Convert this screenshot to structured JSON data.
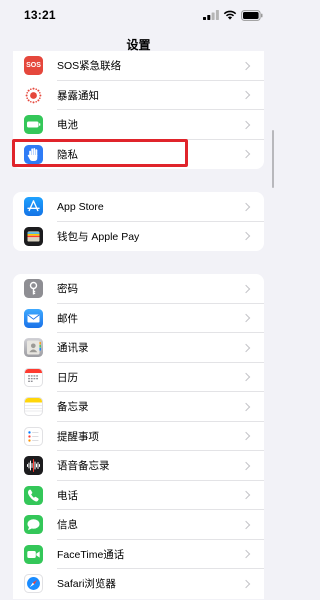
{
  "status_bar": {
    "time": "13:21"
  },
  "nav": {
    "title": "设置"
  },
  "group1": [
    {
      "label": "SOS紧急联络",
      "icon": "sos-icon",
      "color": "#e5473c",
      "icon_text": "SOS"
    },
    {
      "label": "暴露通知",
      "icon": "exposure-notification-icon",
      "color": "#ffffff"
    },
    {
      "label": "电池",
      "icon": "battery-icon",
      "color": "#34c759"
    },
    {
      "label": "隐私",
      "icon": "hand-icon",
      "color": "#2f7cf6"
    }
  ],
  "group2": [
    {
      "label": "App Store",
      "icon": "app-store-icon",
      "color": "#1a8cff"
    },
    {
      "label": "钱包与 Apple Pay",
      "icon": "wallet-icon",
      "color": "#1c1c1e"
    }
  ],
  "group3": [
    {
      "label": "密码",
      "icon": "key-icon",
      "color": "#8e8e93"
    },
    {
      "label": "邮件",
      "icon": "mail-icon",
      "color": "#2b8cf0"
    },
    {
      "label": "通讯录",
      "icon": "contacts-icon",
      "color": "#a6a6ab"
    },
    {
      "label": "日历",
      "icon": "calendar-icon",
      "color": "#ffffff"
    },
    {
      "label": "备忘录",
      "icon": "notes-icon",
      "color": "#ffd60a"
    },
    {
      "label": "提醒事项",
      "icon": "reminders-icon",
      "color": "#ffffff"
    },
    {
      "label": "语音备忘录",
      "icon": "voice-memos-icon",
      "color": "#1c1c1e"
    },
    {
      "label": "电话",
      "icon": "phone-icon",
      "color": "#34c759"
    },
    {
      "label": "信息",
      "icon": "messages-icon",
      "color": "#34c759"
    },
    {
      "label": "FaceTime通话",
      "icon": "facetime-icon",
      "color": "#34c759"
    },
    {
      "label": "Safari浏览器",
      "icon": "safari-icon",
      "color": "#1a8cff"
    }
  ],
  "highlight_color": "#e0242b"
}
